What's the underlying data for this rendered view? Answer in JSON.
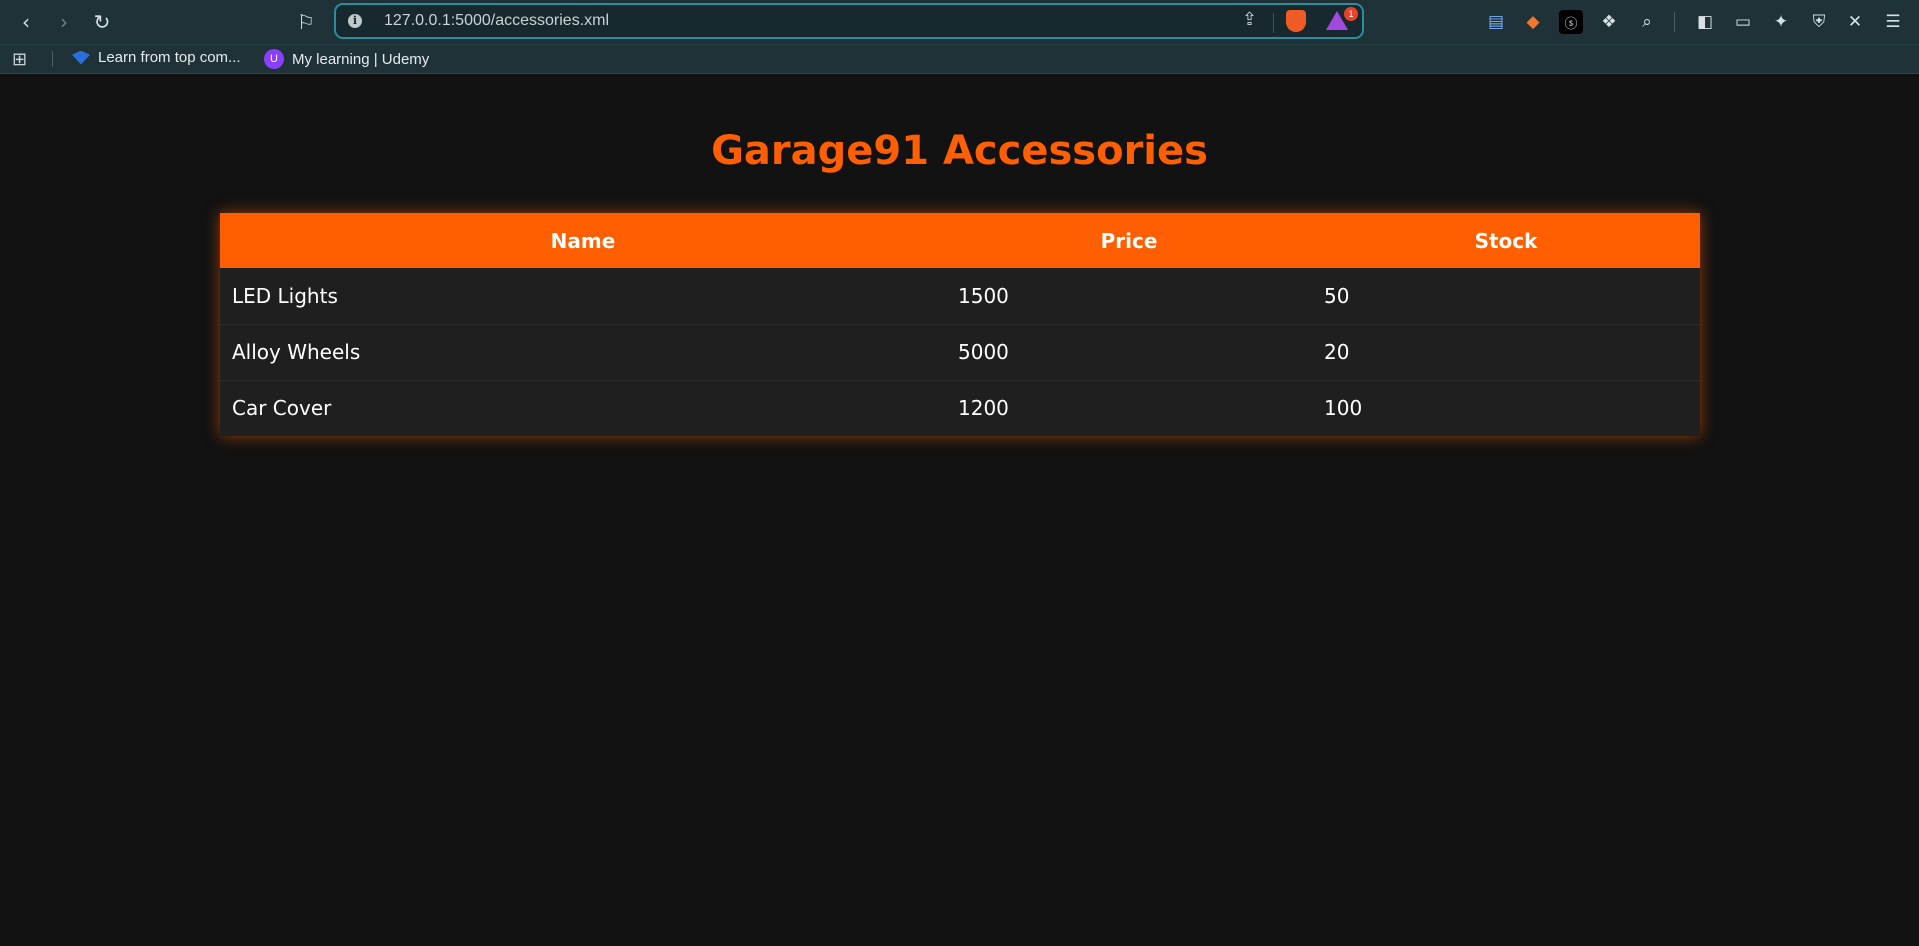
{
  "browser": {
    "url": "127.0.0.1:5000/accessories.xml",
    "rewards_badge": "1",
    "bookmarks": [
      {
        "label": "Learn from top com..."
      },
      {
        "label": "My learning | Udemy"
      }
    ]
  },
  "page": {
    "title": "Garage91 Accessories",
    "table": {
      "headers": [
        "Name",
        "Price",
        "Stock"
      ],
      "rows": [
        [
          "LED Lights",
          "1500",
          "50"
        ],
        [
          "Alloy Wheels",
          "5000",
          "20"
        ],
        [
          "Car Cover",
          "1200",
          "100"
        ]
      ]
    }
  },
  "colors": {
    "accent": "#ff5f00",
    "background": "#121212",
    "row": "#1f1f1f",
    "chrome": "#1e3238"
  }
}
